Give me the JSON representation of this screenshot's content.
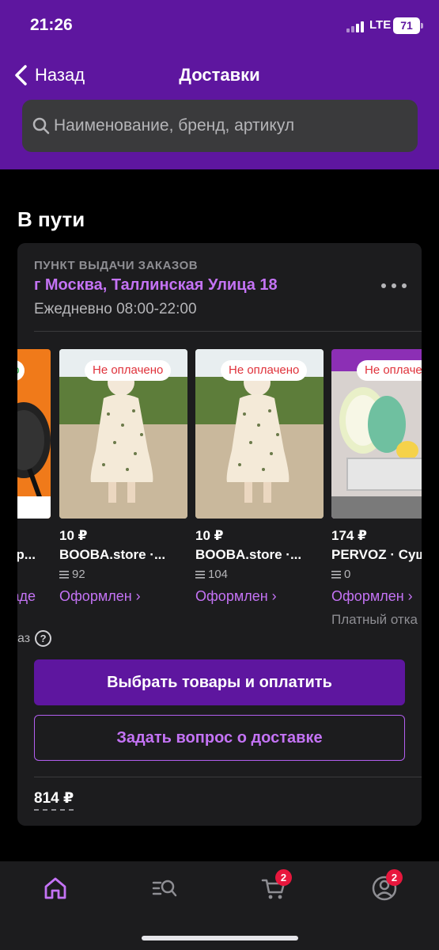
{
  "status_bar": {
    "time": "21:26",
    "network": "LTE",
    "battery": "71"
  },
  "nav": {
    "back_label": "Назад",
    "title": "Доставки"
  },
  "search": {
    "placeholder": "Наименование, бренд, артикул"
  },
  "section": {
    "title": "В пути"
  },
  "pickup": {
    "caption": "ПУНКТ ВЫДАЧИ ЗАКАЗОВ",
    "address": "г Москва, Таллинская Улица 18",
    "hours": "Ежедневно 08:00-22:00"
  },
  "products": [
    {
      "badge": "",
      "badge_partial": "но",
      "price": "",
      "name": "зор...",
      "reviews": "",
      "status": "ладе",
      "refusal": ""
    },
    {
      "badge": "Не оплачено",
      "price": "10 ₽",
      "name": "BOOBA.store ·...",
      "reviews": "92",
      "status": "Оформлен ›",
      "refusal": ""
    },
    {
      "badge": "Не оплачено",
      "price": "10 ₽",
      "name": "BOOBA.store ·...",
      "reviews": "104",
      "status": "Оформлен ›",
      "refusal": ""
    },
    {
      "badge": "Не оплачено",
      "price": "174 ₽",
      "name": "PERVOZ · Суш",
      "reviews": "0",
      "status": "Оформлен ›",
      "refusal": "Платный отка"
    }
  ],
  "help": {
    "text": "аз"
  },
  "actions": {
    "pay_label": "Выбрать товары и оплатить",
    "question_label": "Задать вопрос о доставке"
  },
  "total": "814 ₽",
  "tabbar": {
    "cart_badge": "2",
    "profile_badge": "2"
  },
  "colors": {
    "brand": "#5e169f",
    "accent": "#c473f5",
    "alert": "#e0323b",
    "badge": "#e8173d"
  }
}
